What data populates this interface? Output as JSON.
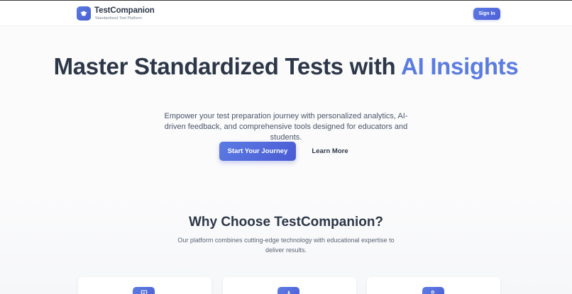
{
  "header": {
    "brand_name": "TestCompanion",
    "brand_tagline": "Standardized Test Platform",
    "logo_icon": "graduation-cap-icon",
    "signin_label": "Sign In"
  },
  "hero": {
    "title_main": "Master Standardized Tests with ",
    "title_accent": "AI Insights",
    "subtitle": "Empower your test preparation journey with personalized analytics, AI-driven feedback, and comprehensive tools designed for educators and students.",
    "primary_button": "Start Your Journey",
    "secondary_button": "Learn More"
  },
  "why": {
    "title": "Why Choose TestCompanion?",
    "subtitle": "Our platform combines cutting-edge technology with educational expertise to deliver results."
  },
  "feature_cards": [
    {
      "icon": "chart-icon"
    },
    {
      "icon": "brain-icon"
    },
    {
      "icon": "users-icon"
    }
  ],
  "colors": {
    "accent": "#5b7ce0",
    "primary_button": "#4f5fd6",
    "text_dark": "#2d3748"
  }
}
